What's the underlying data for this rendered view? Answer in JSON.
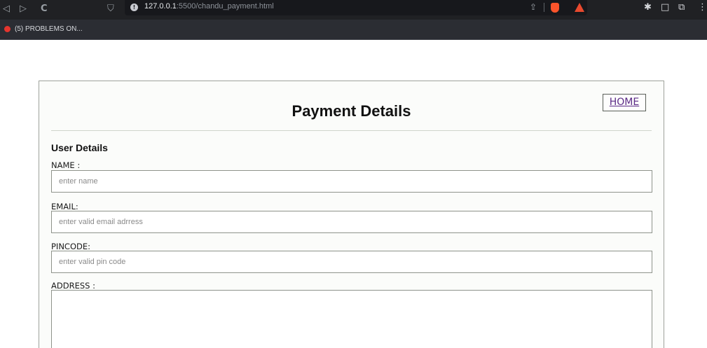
{
  "browser": {
    "nav_glyphs": [
      "◁",
      "▷",
      "C"
    ],
    "bookmark_glyph": "⛉",
    "url_host": "127.0.0.1",
    "url_path": ":5500/chandu_payment.html",
    "info_glyph": "!",
    "share_glyph": "⇪",
    "ext_glyphs": [
      "✱",
      "□",
      "⧉",
      "⋮"
    ],
    "bookmark_tab_label": "(5) PROBLEMS ON..."
  },
  "page": {
    "title": "Payment Details",
    "home_label": "HOME",
    "section_heading": "User Details",
    "fields": [
      {
        "label": "NAME :",
        "placeholder": "enter name"
      },
      {
        "label": "EMAIL:",
        "placeholder": "enter valid email adrress"
      },
      {
        "label": "PINCODE:",
        "placeholder": "enter valid pin code"
      },
      {
        "label": "ADDRESS :",
        "placeholder": ""
      }
    ]
  },
  "colors": {
    "chrome_bg": "#202124",
    "bookmarks_bg": "#2b2d33",
    "link": "#5b2a86",
    "card_border": "#9ea29c"
  }
}
